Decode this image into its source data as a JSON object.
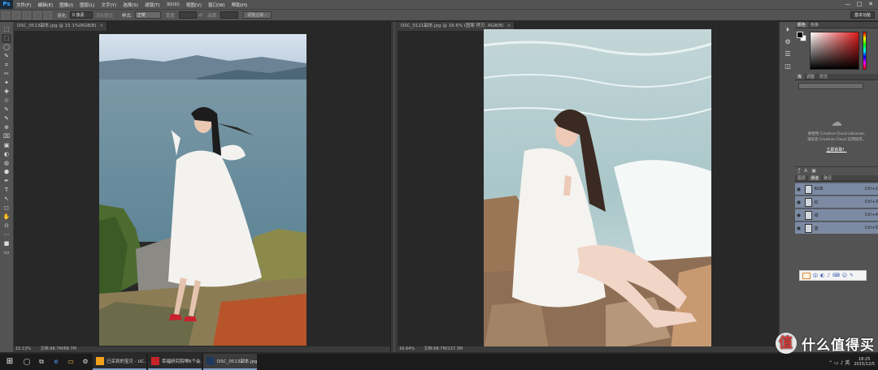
{
  "menubar": {
    "logo": "Ps",
    "items": [
      "文件(F)",
      "编辑(E)",
      "图像(I)",
      "图层(L)",
      "文字(Y)",
      "选择(S)",
      "滤镜(T)",
      "3D(D)",
      "视图(V)",
      "窗口(W)",
      "帮助(H)"
    ],
    "minimize": "—",
    "maximize": "□",
    "close": "✕"
  },
  "options": {
    "feather_label": "羽化:",
    "feather_value": "0 像素",
    "antialias": "消除锯齿",
    "style_label": "样式:",
    "style_value": "正常",
    "width_label": "宽度:",
    "height_label": "高度:",
    "refine_edge": "调整边缘...",
    "workspace": "基本功能"
  },
  "tools": [
    "⬚",
    "⬚",
    "◯",
    "✎",
    "⌗",
    "✂",
    "✦",
    "✚",
    "⟐",
    "✎",
    "✎",
    "⊕",
    "⌧",
    "▣",
    "◐",
    "◍",
    "⬢",
    "✒",
    "T",
    "↖",
    "◻",
    "✋",
    "⊙",
    "⋯",
    "■",
    "▭"
  ],
  "doc_left": {
    "tab": "DSC_0513副本.jpg @ 15.1%(RGB/8)",
    "close": "×",
    "zoom": "15.13%",
    "info": "文档:68.7M/68.7M"
  },
  "doc_right": {
    "tab": "DSC_0121副本.jpg @ 16.6% (图案 拷贝, RGB/8)",
    "close": "×",
    "zoom": "16.64%",
    "info": "文档:68.7M/137.3M"
  },
  "side_icons": [
    "⏵",
    "⚙",
    "☰",
    "◫"
  ],
  "color_panel": {
    "tabs": [
      "颜色",
      "色板"
    ]
  },
  "library_panel": {
    "tabs": [
      "库",
      "调整",
      "样式"
    ],
    "text1": "要使用 Creative Cloud Libraries,",
    "text2": "请安装 Creative Cloud 应用程序。",
    "link": "立即获取！"
  },
  "channels_panel": {
    "tabs": [
      "图层",
      "通道",
      "路径"
    ],
    "rows": [
      {
        "name": "RGB",
        "key": "Ctrl+2"
      },
      {
        "name": "红",
        "key": "Ctrl+3"
      },
      {
        "name": "绿",
        "key": "Ctrl+4"
      },
      {
        "name": "蓝",
        "key": "Ctrl+5"
      }
    ]
  },
  "taskbar": {
    "start": "⊞",
    "icons": [
      "◯",
      "⧉",
      "e",
      "▭",
      "⚙"
    ],
    "tasks": [
      {
        "label": "已买到的宝贝 - UC...",
        "color": "#f2a21b"
      },
      {
        "label": "幸福研究院啤6个会...",
        "color": "#c8232b"
      },
      {
        "label": "DSC_0513副本.jpg...",
        "color": "#1f3a5c"
      }
    ],
    "tray_icons": "⌃ ▭ ♪ 英",
    "time": "18:25",
    "date": "2015/12/5",
    "watermark": "什么值得买",
    "watermark_badge": "值"
  }
}
